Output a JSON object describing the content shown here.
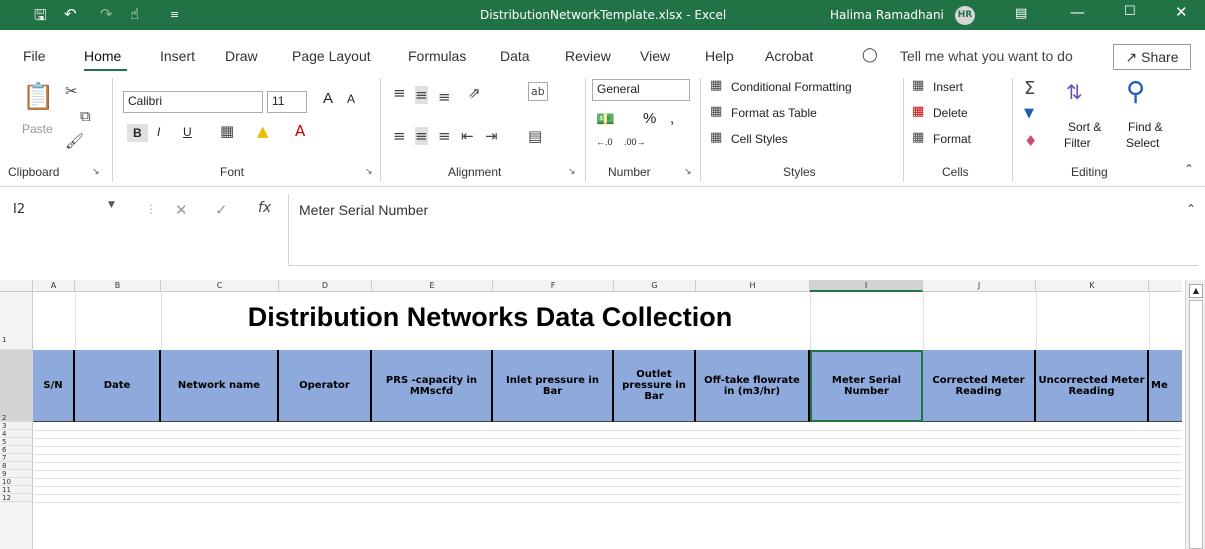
{
  "titlebar": {
    "save_icon": "save-icon",
    "undo_icon": "undo-icon",
    "redo_icon": "redo-icon",
    "touch_icon": "touch-mode-icon",
    "title": "DistributionNetworkTemplate.xlsx  -  Excel",
    "user": "Halima Ramadhani",
    "avatar": "HR",
    "colors": {
      "bar": "#217346"
    }
  },
  "tabs": [
    "File",
    "Home",
    "Insert",
    "Draw",
    "Page Layout",
    "Formulas",
    "Data",
    "Review",
    "View",
    "Help",
    "Acrobat"
  ],
  "active_tab": "Home",
  "tell_me": "Tell me what you want to do",
  "share": "Share",
  "ribbon": {
    "clipboard": {
      "paste": "Paste",
      "label": "Clipboard"
    },
    "font": {
      "name": "Calibri",
      "size": "11",
      "bold": "B",
      "italic": "I",
      "underline": "U",
      "grow": "A",
      "shrink": "A",
      "label": "Font"
    },
    "alignment": {
      "label": "Alignment"
    },
    "number": {
      "format": "General",
      "percent": "%",
      "comma": ",",
      "label": "Number"
    },
    "styles": {
      "conditional": "Conditional Formatting",
      "table": "Format as Table",
      "cell": "Cell Styles",
      "label": "Styles"
    },
    "cells": {
      "insert": "Insert",
      "delete": "Delete",
      "format": "Format",
      "label": "Cells"
    },
    "editing": {
      "sort": "Sort &",
      "filter": "Filter",
      "find": "Find &",
      "select": "Select",
      "label": "Editing"
    }
  },
  "formula_bar": {
    "name_box": "I2",
    "fx": "fx",
    "content": "Meter Serial Number"
  },
  "sheet": {
    "columns": [
      "A",
      "B",
      "C",
      "D",
      "E",
      "F",
      "G",
      "H",
      "I",
      "J",
      "K"
    ],
    "selected_column": "I",
    "rows": [
      "1",
      "2",
      "3",
      "4",
      "5",
      "6",
      "7",
      "8",
      "9",
      "10",
      "11",
      "12"
    ],
    "title": "Distribution  Networks Data Collection",
    "headers": [
      "S/N",
      "Date",
      "Network name",
      "Operator",
      "PRS -capacity in MMscfd",
      "Inlet pressure in Bar",
      "Outlet pressure in Bar",
      "Off-take flowrate in (m3/hr)",
      "Meter Serial Number",
      "Corrected Meter Reading",
      "Uncorrected Meter Reading",
      "Me"
    ],
    "header_color": "#8ea9db"
  }
}
